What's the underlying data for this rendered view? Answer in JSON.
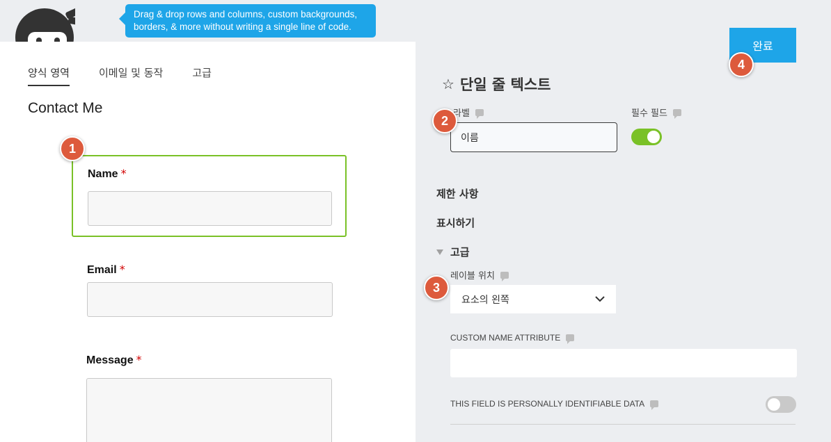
{
  "banner": {
    "tip_line1": "Drag & drop rows and columns, custom backgrounds,",
    "tip_line2": "borders, & more without writing a single line of code."
  },
  "tabs": [
    {
      "label": "양식 영역",
      "active": true
    },
    {
      "label": "이메일 및 동작",
      "active": false
    },
    {
      "label": "고급",
      "active": false
    }
  ],
  "form": {
    "title": "Contact Me",
    "fields": [
      {
        "label": "Name",
        "required_mark": "*"
      },
      {
        "label": "Email",
        "required_mark": "*"
      },
      {
        "label": "Message",
        "required_mark": "*"
      }
    ]
  },
  "settings": {
    "done_label": "완료",
    "field_type_title": "단일 줄 텍스트",
    "label_caption": "라벨",
    "label_value": "이름",
    "required_caption": "필수 필드",
    "required_on": true,
    "sections": [
      {
        "label": "제한 사항",
        "expanded": false
      },
      {
        "label": "표시하기",
        "expanded": false
      },
      {
        "label": "고급",
        "expanded": true
      }
    ],
    "label_position_caption": "레이블 위치",
    "label_position_value": "요소의 왼쪽",
    "custom_name_caption": "CUSTOM NAME ATTRIBUTE",
    "custom_name_value": "",
    "pii_caption": "THIS FIELD IS PERSONALLY IDENTIFIABLE DATA",
    "pii_on": false
  },
  "steps": [
    "1",
    "2",
    "3",
    "4"
  ],
  "colors": {
    "accent_blue": "#1ea5e8",
    "toggle_green": "#7ac127",
    "step_red": "#dd5a3c",
    "required_red": "#d20000"
  }
}
